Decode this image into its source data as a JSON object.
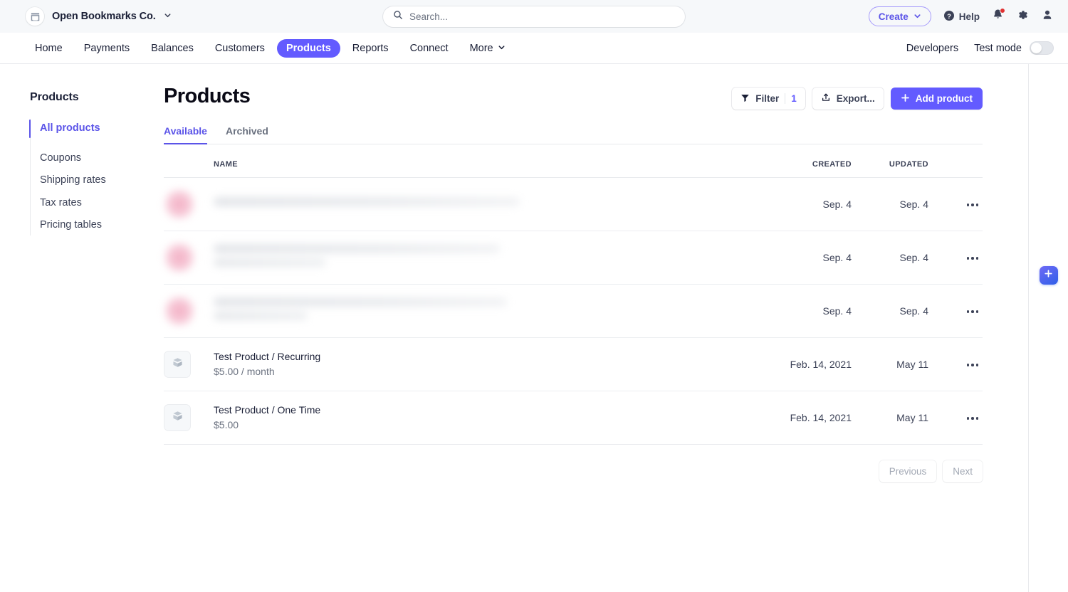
{
  "topbar": {
    "merchant_name": "Open Bookmarks Co.",
    "merchant_icon": "store-icon",
    "merchant_chevron": "chevron-down-icon",
    "search_placeholder": "Search...",
    "search_value": "",
    "search_icon": "search-icon",
    "create_label": "Create",
    "help_label": "Help",
    "help_icon": "question-circle-icon",
    "notifications_icon": "bell-icon",
    "settings_icon": "gear-icon",
    "account_icon": "user-avatar-icon"
  },
  "nav": {
    "items": [
      {
        "label": "Home",
        "active": false
      },
      {
        "label": "Payments",
        "active": false
      },
      {
        "label": "Balances",
        "active": false
      },
      {
        "label": "Customers",
        "active": false
      },
      {
        "label": "Products",
        "active": true
      },
      {
        "label": "Reports",
        "active": false
      },
      {
        "label": "Connect",
        "active": false
      },
      {
        "label": "More",
        "active": false
      }
    ],
    "developers_label": "Developers",
    "test_mode_label": "Test mode",
    "test_mode_on": false
  },
  "sidebar": {
    "heading": "Products",
    "items": [
      {
        "label": "All products",
        "active": true
      },
      {
        "label": "Coupons",
        "active": false
      },
      {
        "label": "Shipping rates",
        "active": false
      },
      {
        "label": "Tax rates",
        "active": false
      },
      {
        "label": "Pricing tables",
        "active": false
      }
    ]
  },
  "main": {
    "title": "Products",
    "toolbar": {
      "filter_label": "Filter",
      "filter_count": "1",
      "filter_icon": "funnel-icon",
      "export_label": "Export...",
      "export_icon": "export-icon",
      "add_product_label": "Add product",
      "add_product_icon": "plus-icon"
    },
    "tabs": [
      {
        "label": "Available",
        "active": true
      },
      {
        "label": "Archived",
        "active": false
      }
    ],
    "table": {
      "columns": [
        "NAME",
        "CREATED",
        "UPDATED"
      ],
      "rows": [
        {
          "redacted": true,
          "lines": 1,
          "name": "",
          "price": "",
          "created": "Sep. 4",
          "updated": "Sep. 4"
        },
        {
          "redacted": true,
          "lines": 2,
          "name": "",
          "price": "",
          "created": "Sep. 4",
          "updated": "Sep. 4"
        },
        {
          "redacted": true,
          "lines": 2,
          "name": "",
          "price": "",
          "created": "Sep. 4",
          "updated": "Sep. 4"
        },
        {
          "redacted": false,
          "lines": 2,
          "name": "Test Product / Recurring",
          "price": "$5.00 / month",
          "created": "Feb. 14, 2021",
          "updated": "May 11"
        },
        {
          "redacted": false,
          "lines": 2,
          "name": "Test Product / One Time",
          "price": "$5.00",
          "created": "Feb. 14, 2021",
          "updated": "May 11"
        }
      ],
      "row_menu_icon": "overflow-menu-icon",
      "product_thumb_icon": "layers-box-icon"
    },
    "pagination": {
      "previous_label": "Previous",
      "next_label": "Next",
      "previous_enabled": false,
      "next_enabled": false
    }
  },
  "right_rail": {
    "fab_icon": "plus-icon"
  },
  "colors": {
    "accent": "#635bff",
    "accent_text": "#5b54e8",
    "notification": "#e03131",
    "header_bg": "#f6f8fa"
  }
}
